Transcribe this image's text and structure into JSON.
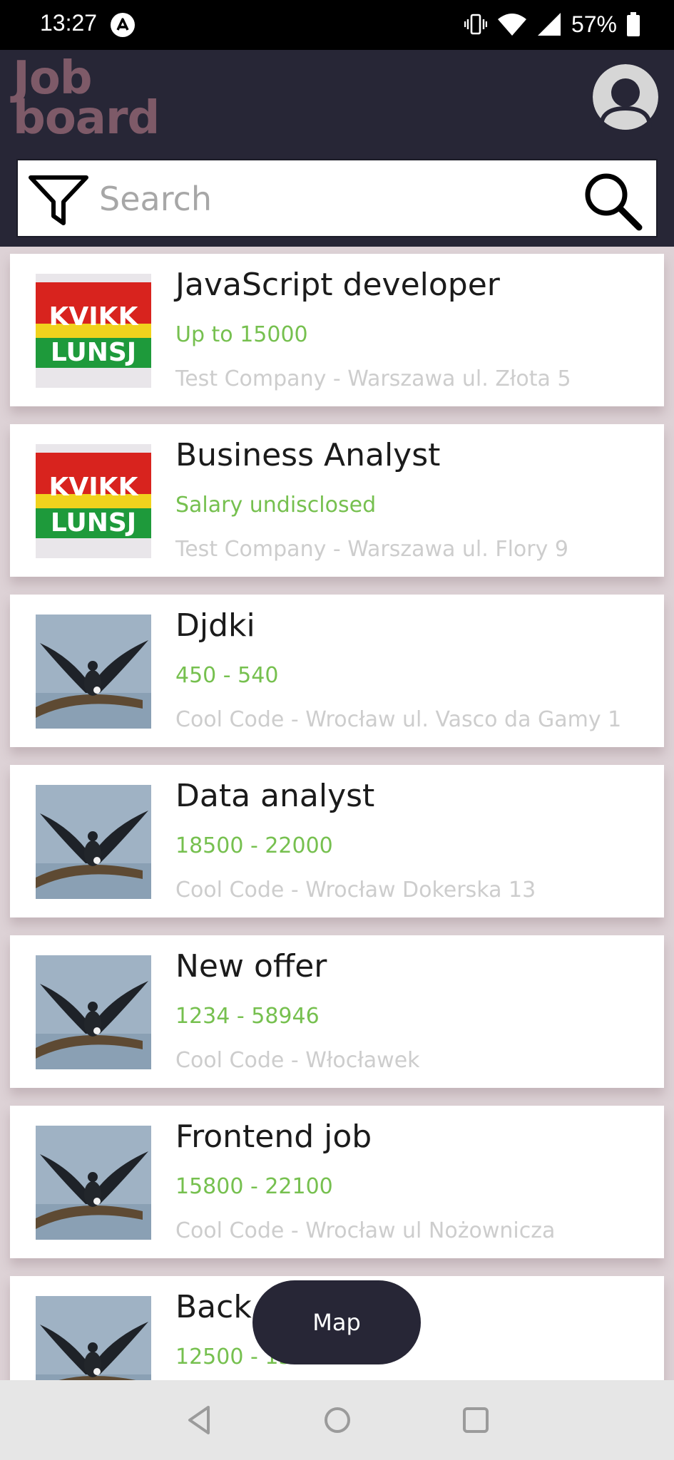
{
  "status_bar": {
    "time": "13:27",
    "battery": "57%",
    "icons": [
      "react-native-icon",
      "vibrate-icon",
      "wifi-icon",
      "signal-icon",
      "battery-icon"
    ]
  },
  "header": {
    "logo_line1": "Job",
    "logo_line2": "board",
    "avatar_icon": "user-avatar-icon"
  },
  "search": {
    "placeholder": "Search",
    "value": "",
    "filter_icon": "filter-icon",
    "search_icon": "search-icon"
  },
  "jobs": [
    {
      "title": "JavaScript developer",
      "salary": "Up to 15000",
      "company": "Test Company - Warszawa ul. Złota 5",
      "logo": "kvikk-lunsj-logo"
    },
    {
      "title": "Business Analyst",
      "salary": "Salary undisclosed",
      "company": "Test Company - Warszawa ul. Flory 9",
      "logo": "kvikk-lunsj-logo"
    },
    {
      "title": "Djdki",
      "salary": "450 - 540",
      "company": "Cool Code - Wrocław ul. Vasco da Gamy 1",
      "logo": "cormorant-logo"
    },
    {
      "title": "Data analyst",
      "salary": "18500 - 22000",
      "company": "Cool Code - Wrocław Dokerska 13",
      "logo": "cormorant-logo"
    },
    {
      "title": "New offer",
      "salary": "1234 - 58946",
      "company": "Cool Code - Włocławek",
      "logo": "cormorant-logo"
    },
    {
      "title": "Frontend job",
      "salary": "15800 - 22100",
      "company": "Cool Code - Wrocław ul Nożownicza",
      "logo": "cormorant-logo"
    },
    {
      "title": "Back",
      "salary": "12500 - 15450",
      "company": "",
      "logo": "cormorant-logo"
    }
  ],
  "map_button": {
    "label": "Map"
  },
  "colors": {
    "header_bg": "#272636",
    "logo": "#7e5a68",
    "salary": "#76c04f",
    "company": "#cdcdcd"
  }
}
